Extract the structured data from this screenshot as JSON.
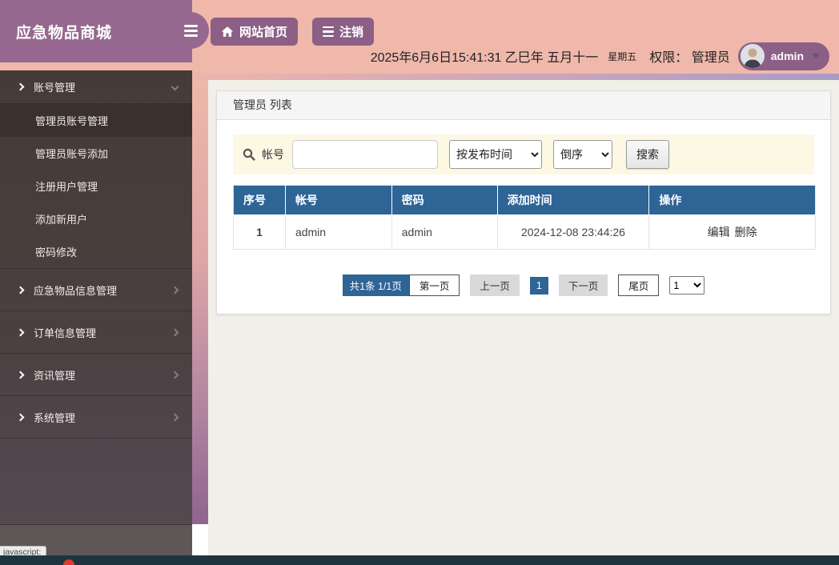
{
  "app": {
    "title": "应急物品商城"
  },
  "topbar": {
    "home_button": "网站首页",
    "logout_button": "注销",
    "datetime": "2025年6月6日15:41:31 乙巳年 五月十一",
    "weekday": "星期五",
    "permission_label": "权限：",
    "permission_value": "管理员",
    "username": "admin"
  },
  "sidebar": {
    "sections": [
      {
        "label": "账号管理",
        "expanded": true,
        "children": [
          "管理员账号管理",
          "管理员账号添加",
          "注册用户管理",
          "添加新用户",
          "密码修改"
        ],
        "active_child_index": 0
      },
      {
        "label": "应急物品信息管理",
        "expanded": false
      },
      {
        "label": "订单信息管理",
        "expanded": false
      },
      {
        "label": "资讯管理",
        "expanded": false
      },
      {
        "label": "系统管理",
        "expanded": false
      }
    ]
  },
  "panel": {
    "title": "管理员 列表",
    "search": {
      "field_label": "帐号",
      "input_value": "",
      "sort_field_selected": "按发布时间",
      "sort_order_selected": "倒序",
      "submit_label": "搜索"
    },
    "table": {
      "headers": [
        "序号",
        "帐号",
        "密码",
        "添加时间",
        "操作"
      ],
      "rows": [
        {
          "index": "1",
          "account": "admin",
          "password": "admin",
          "added_time": "2024-12-08 23:44:26",
          "actions": [
            "编辑",
            "删除"
          ]
        }
      ]
    },
    "pagination": {
      "summary": "共1条  1/1页",
      "first": "第一页",
      "prev": "上一页",
      "current": "1",
      "next": "下一页",
      "last": "尾页",
      "page_select_value": "1"
    }
  },
  "statusbar": {
    "link_hint": "javascript:"
  },
  "icons": {
    "hamburger": "menu-icon",
    "home": "home-icon",
    "logout": "list-icon",
    "search": "magnifier-icon",
    "caret": "caret-down-icon"
  },
  "colors": {
    "brand_purple": "#96688f",
    "button_purple": "#8c5f86",
    "topbar_salmon": "#f0b8ab",
    "sidebar_brown": "#463b37",
    "table_header_blue": "#2e6496",
    "search_bg_cream": "#fcf8e3",
    "content_bg": "#f0efe8",
    "bottom_bar_teal": "#1e3540",
    "notification_red": "#e0392e"
  }
}
